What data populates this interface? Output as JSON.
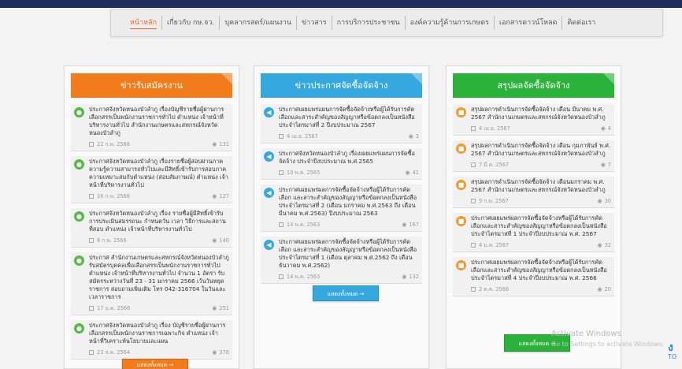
{
  "colors": {
    "orange": "#f27b1b",
    "blue": "#36a8e0",
    "green": "#2bb23b",
    "icon_green": "#58b947",
    "icon_blue": "#36a8e0",
    "icon_orange": "#f29a2e",
    "nav_active": "#e76a1c"
  },
  "nav": {
    "items": [
      {
        "label": "หน้าหลัก",
        "active": true
      },
      {
        "label": "เกี่ยวกับ กษ.จว.",
        "active": false
      },
      {
        "label": "บุคลากรสตร์/แผนงาน",
        "active": false
      },
      {
        "label": "ข่าวสาร",
        "active": false
      },
      {
        "label": "การบริการประชาชน",
        "active": false
      },
      {
        "label": "องค์ความรู้ด้านการเกษตร",
        "active": false
      },
      {
        "label": "เอกสารดาวน์โหลด",
        "active": false
      },
      {
        "label": "ติดต่อเรา",
        "active": false
      }
    ]
  },
  "panels": [
    {
      "title": "ข่าวรับสมัครงาน",
      "icon": "user-icon",
      "items": [
        {
          "title": "ประกาศจังหวัดหนองบัวลำภู เรื่องบัญชีรายชื่อผู้ผ่านการเลือกสรรเป็นพนักงานราชการทั่วไป ตำแหน่ง เจ้าหน้าที่บริหารงานทั่วไป สำนักงานเกษตรและสหกรณ์จังหวัดหนองบัวลำภู",
          "date": "22 ก.พ. 2566",
          "views": "131"
        },
        {
          "title": "ประกาศจังหวัดหนองบัวลำภู เรื่องรายชื่อผู้สอบผ่านภาคความรู้ความสามารถทั่วไปและมีสิทธิ์เข้ารับการสอบภาคความเหมาะสมกับตำแหน่ง (สอบสัมภาษณ์) ตำแหน่ง เจ้าหน้าที่บริหารงานทั่วไป",
          "date": "16 ก.พ. 2566",
          "views": "127"
        },
        {
          "title": "ประกาศจังหวัดหนองบัวลำภู เรื่อง รายชื่อผู้มีสิทธิ์เข้ารับการประเมินสมรรถนะ กำหนดวัน เวลา วิธีการและสถานที่สอบ ตำแหน่ง เจ้าหน้าที่บริหารงานทั่วไป",
          "date": "8 ก.พ. 2566",
          "views": "140"
        },
        {
          "title": "ประกาศ สำนักงานเกษตรและสหกรณ์จังหวัดหนองบัวลำภู รับสมัครบุคคลเพื่อเลือกสรรเป็นพนักงานราชการทั่วไป ตำแหน่ง เจ้าหน้าที่บริหารงานทั่วไป จำนวน 1 อัตรา รับสมัครระหว่างวันที่ 23 - 31 มกราคม 2566 เว้นวันหยุดราชการ สอบถามเพิ่มเติม โทร 042-316704 ในวันและเวลาราชการ",
          "date": "17 ม.ค. 2566",
          "views": "251"
        },
        {
          "title": "ประกาศจังหวัดหนองบัวลำภู เรื่อง บัญชีรายชื่อผู้ผ่านการเลือกสรรเป็นพนักงานราชการเฉพาะกิจ ตำแหน่ง เจ้าหน้าที่วิเคราะห์นโยบายและแผน",
          "date": "23 ส.ค. 2564",
          "views": "378"
        }
      ],
      "more_label": "แสดงทั้งหมด →"
    },
    {
      "title": "ข่าวประกาศจัดซื้อจัดจ้าง",
      "icon": "megaphone-icon",
      "items": [
        {
          "title": "ประกาศเผยแพร่แผนการจัดซื้อจัดจ้างหรือผู้ได้รับการคัดเลือกและสาระสำคัญของสัญญาหรือข้อตกลงเป็นหนังสือ ประจำไตรมาสที่ 2 ปีงบประมาณ 2567",
          "date": "4 เม.ย. 2567",
          "views": "3"
        },
        {
          "title": "ประกาศจังหวัดหนองบัวลำภู เรื่องเผยแพร่แผนการจัดซื้อจัดจ้าง ประจำปีงบประมาณ พ.ศ.2565",
          "date": "10 พ.ค. 2565",
          "views": "41"
        },
        {
          "title": "ประกาศเผยแพร่ผลการจัดซื้อจัดจ้างหรือผู้ได้รับการคัดเลือก และสาระสำคัญของสัญญาหรือข้อตกลงเป็นหนังสือ ประจำไตรมาสที่ 2 (เดือน มกราคม พ.ศ.2563 ถึง เดือน มีนาคม พ.ศ.2563) ปีงบประมาณ 2563",
          "date": "14 พ.ค. 2563",
          "views": "167"
        },
        {
          "title": "ประกาศเผยแพร่ผลการจัดซื้อจัดจ้างหรือผู้ได้รับการคัดเลือก และสาระสำคัญของสัญญาหรือข้อตกลงเป็นหนังสือ ประจำไตรมาสที่ 1 (เดือน ตุลาคม พ.ศ.2562 ถึง เดือน ธันวาคม พ.ศ.2562)",
          "date": "14 พ.ค. 2563",
          "views": "132"
        }
      ],
      "more_label": "แสดงทั้งหมด →"
    },
    {
      "title": "สรุปผลจัดซื้อจัดจ้าง",
      "icon": "document-icon",
      "items": [
        {
          "title": "สรุปผลการดำเนินการจัดซื้อจัดจ้าง เดือน มีนาคม พ.ศ. 2567 สำนักงานเกษตรและสหกรณ์จังหวัดหนองบัวลำภู",
          "date": "4 เม.ย. 2567",
          "views": "4"
        },
        {
          "title": "สรุปผลการดำเนินการจัดซื้อจัดจ้าง เดือน กุมภาพันธ์ พ.ศ. 2567 สำนักงานเกษตรและสหกรณ์จังหวัดหนองบัวลำภู",
          "date": "7 มี.ค. 2567",
          "views": "7"
        },
        {
          "title": "สรุปผลการดำเนินการจัดซื้อจัดจ้าง เดือนมกราคม พ.ศ. 2567 สำนักงานเกษตรและสหกรณ์จังหวัดหนองบัวลำภู",
          "date": "9 ก.พ. 2567",
          "views": "30"
        },
        {
          "title": "ประกาศเผยแพร่ผลการจัดซื้อจัดจ้างหรือผู้ได้รับการคัดเลือกและสาระสำคัญของสัญญาหรือข้อตกลงเป็นหนังสือ ประจำไตรมาสที่ 1 ประจำปีงบประมาณ พ.ศ. 2567",
          "date": "4 ม.ค. 2567",
          "views": "32"
        },
        {
          "title": "ประกาศเผยแพร่ผลการจัดซื้อจัดจ้างหรือผู้ได้รับการคัดเลือกและสาระสำคัญของสัญญาหรือข้อตกลงเป็นหนังสือ ประจำไตรมาสที่ 4 ประจำปีงบประมาณ พ.ศ. 2566",
          "date": "2 ต.ค. 2566",
          "views": "20"
        }
      ],
      "more_label": "แสดงทั้งหมด →"
    }
  ],
  "watermark": {
    "line1": "Activate Windows",
    "line2": "Go to Settings to activate Windows."
  },
  "side_logo": {
    "letter": "ง",
    "text": "TO"
  }
}
